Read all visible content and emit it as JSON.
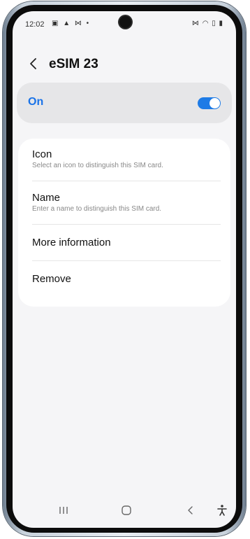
{
  "status_bar": {
    "time": "12:02",
    "left_icons": "▣ ▲ ⋈ •",
    "right_icons": "⋈ ◠ ▯ ▮"
  },
  "header": {
    "title": "eSIM 23",
    "back_icon": "chevron-left-icon"
  },
  "toggle_row": {
    "label": "On",
    "state": "on",
    "accent_color": "#1e7be6"
  },
  "settings_list": {
    "items": [
      {
        "title": "Icon",
        "subtitle": "Select an icon to distinguish this SIM card."
      },
      {
        "title": "Name",
        "subtitle": "Enter a name to distinguish this SIM card."
      },
      {
        "title": "More information"
      },
      {
        "title": "Remove"
      }
    ]
  },
  "nav_bar": {
    "buttons": [
      "recent-apps-icon",
      "home-icon",
      "back-icon",
      "accessibility-icon"
    ]
  }
}
